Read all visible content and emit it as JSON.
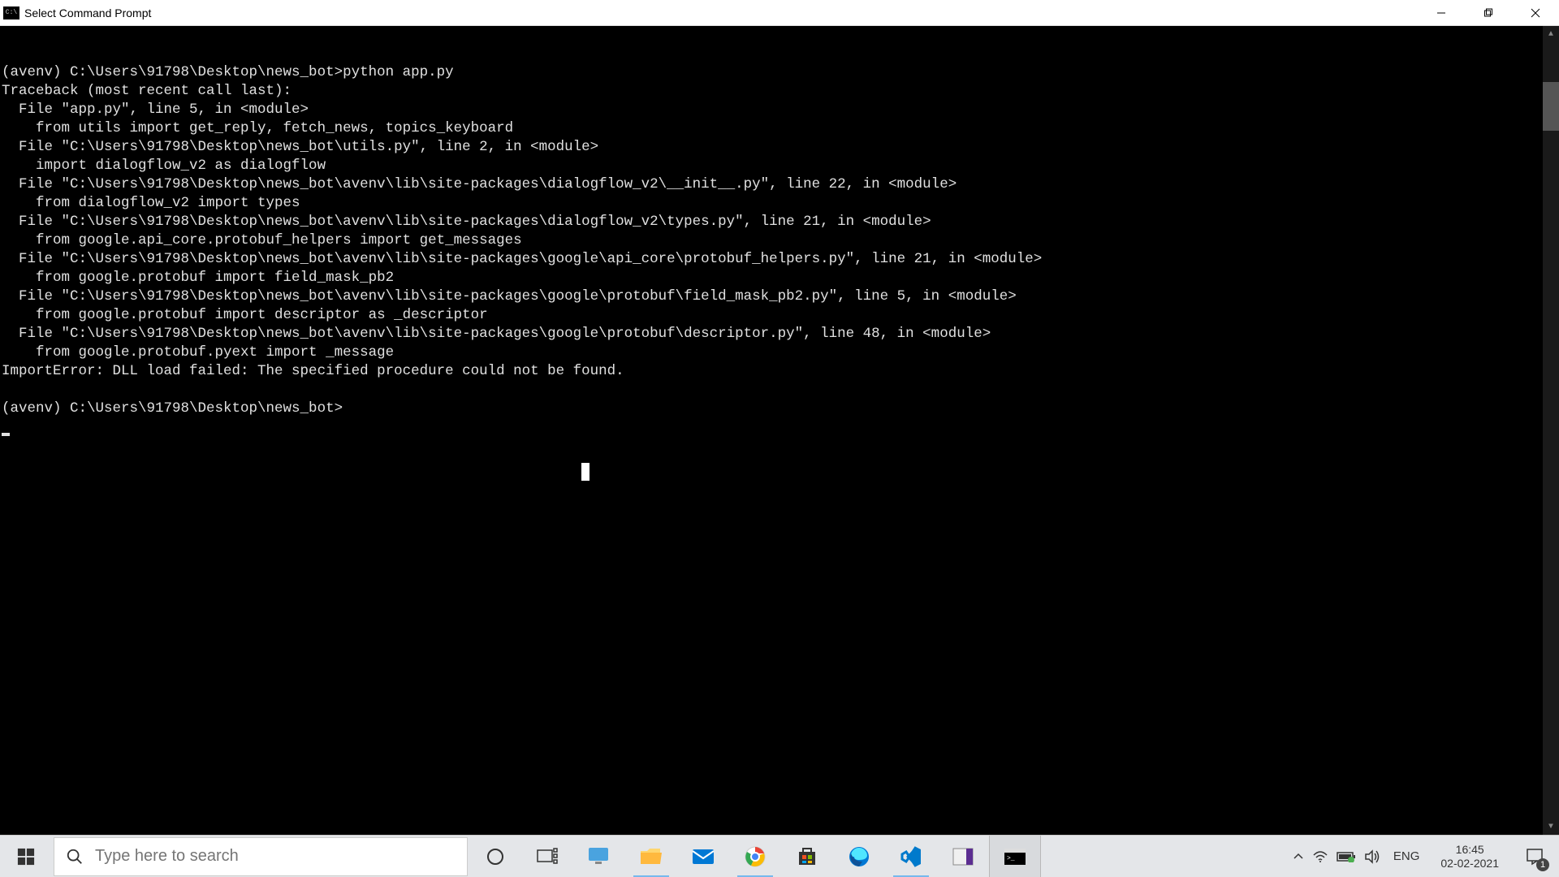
{
  "window": {
    "title": "Select Command Prompt",
    "icon_label": "C:\\"
  },
  "terminal": {
    "lines": [
      "(avenv) C:\\Users\\91798\\Desktop\\news_bot>python app.py",
      "Traceback (most recent call last):",
      "  File \"app.py\", line 5, in <module>",
      "    from utils import get_reply, fetch_news, topics_keyboard",
      "  File \"C:\\Users\\91798\\Desktop\\news_bot\\utils.py\", line 2, in <module>",
      "    import dialogflow_v2 as dialogflow",
      "  File \"C:\\Users\\91798\\Desktop\\news_bot\\avenv\\lib\\site-packages\\dialogflow_v2\\__init__.py\", line 22, in <module>",
      "    from dialogflow_v2 import types",
      "  File \"C:\\Users\\91798\\Desktop\\news_bot\\avenv\\lib\\site-packages\\dialogflow_v2\\types.py\", line 21, in <module>",
      "    from google.api_core.protobuf_helpers import get_messages",
      "  File \"C:\\Users\\91798\\Desktop\\news_bot\\avenv\\lib\\site-packages\\google\\api_core\\protobuf_helpers.py\", line 21, in <module>",
      "    from google.protobuf import field_mask_pb2",
      "  File \"C:\\Users\\91798\\Desktop\\news_bot\\avenv\\lib\\site-packages\\google\\protobuf\\field_mask_pb2.py\", line 5, in <module>",
      "    from google.protobuf import descriptor as _descriptor",
      "  File \"C:\\Users\\91798\\Desktop\\news_bot\\avenv\\lib\\site-packages\\google\\protobuf\\descriptor.py\", line 48, in <module>",
      "    from google.protobuf.pyext import _message",
      "ImportError: DLL load failed: The specified procedure could not be found.",
      "",
      "(avenv) C:\\Users\\91798\\Desktop\\news_bot>"
    ]
  },
  "taskbar": {
    "search_placeholder": "Type here to search",
    "lang": "ENG",
    "time": "16:45",
    "date": "02-02-2021",
    "notif_count": "1"
  }
}
